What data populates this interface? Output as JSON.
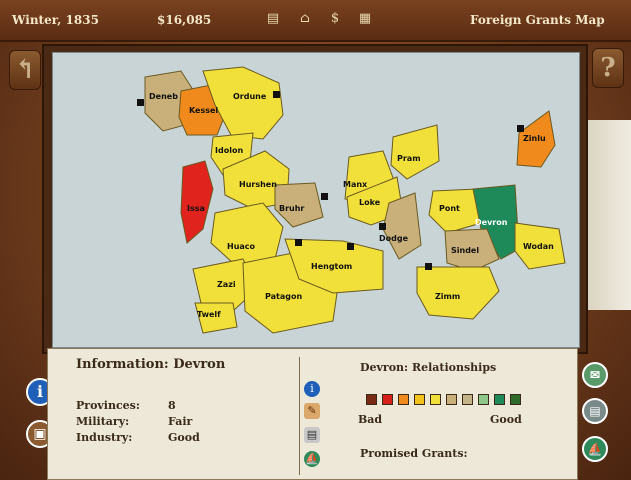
{
  "topbar": {
    "season": "Winter, 1835",
    "money": "$16,085",
    "screen_title": "Foreign Grants Map"
  },
  "map": {
    "provinces": [
      {
        "name": "Deneb",
        "color": "#c9b07a"
      },
      {
        "name": "Kessel",
        "color": "#f08a1c"
      },
      {
        "name": "Ordune",
        "color": "#f2e03a"
      },
      {
        "name": "Idolon",
        "color": "#f2e03a"
      },
      {
        "name": "Issa",
        "color": "#e0231c"
      },
      {
        "name": "Hurshen",
        "color": "#f2e03a"
      },
      {
        "name": "Bruhr",
        "color": "#c9b07a"
      },
      {
        "name": "Huaco",
        "color": "#f2e03a"
      },
      {
        "name": "Zazi",
        "color": "#f2e03a"
      },
      {
        "name": "Twelf",
        "color": "#f2e03a"
      },
      {
        "name": "Patagon",
        "color": "#f2e03a"
      },
      {
        "name": "Hengtom",
        "color": "#f2e03a"
      },
      {
        "name": "Manx",
        "color": "#f2e03a"
      },
      {
        "name": "Pram",
        "color": "#f2e03a"
      },
      {
        "name": "Loke",
        "color": "#f2e03a"
      },
      {
        "name": "Dodge",
        "color": "#c9b07a"
      },
      {
        "name": "Pont",
        "color": "#f2e03a"
      },
      {
        "name": "Devron",
        "color": "#1e8a5a"
      },
      {
        "name": "Sindel",
        "color": "#c9b07a"
      },
      {
        "name": "Wodan",
        "color": "#f2e03a"
      },
      {
        "name": "Zimm",
        "color": "#f2e03a"
      },
      {
        "name": "Zinlu",
        "color": "#f08a1c"
      }
    ]
  },
  "info": {
    "heading_label": "Information:",
    "selected": "Devron",
    "rows": [
      {
        "label": "Provinces:",
        "value": "8"
      },
      {
        "label": "Military:",
        "value": "Fair"
      },
      {
        "label": "Industry:",
        "value": "Good"
      }
    ]
  },
  "relationships": {
    "title": "Devron: Relationships",
    "scale_colors": [
      "#7a2a14",
      "#d6201a",
      "#f08a1c",
      "#f2c21c",
      "#f2e03a",
      "#c9b07a",
      "#c4b48a",
      "#8ec78a",
      "#1e8a5a",
      "#2e6a2a"
    ],
    "bad_label": "Bad",
    "good_label": "Good",
    "promised_label": "Promised Grants:"
  }
}
